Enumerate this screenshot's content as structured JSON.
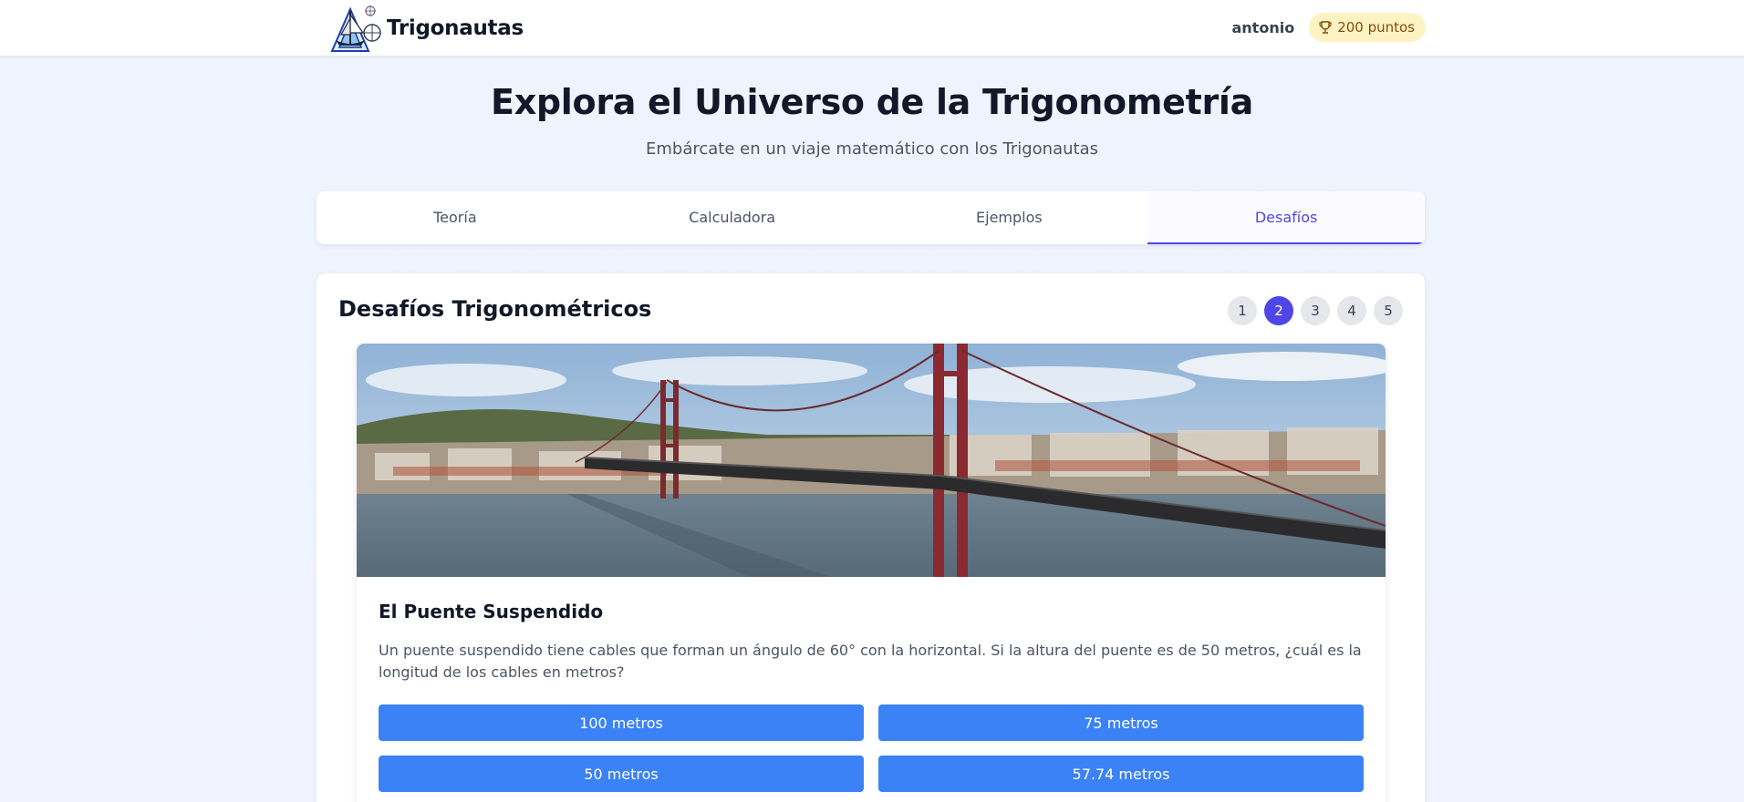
{
  "header": {
    "brand": "Trigonautas",
    "username": "antonio",
    "points": "200 puntos",
    "logo_icon": "compass-ship-logo-icon",
    "points_icon": "trophy-icon"
  },
  "hero": {
    "title": "Explora el Universo de la Trigonometría",
    "subtitle": "Embárcate en un viaje matemático con los Trigonautas"
  },
  "tabs": [
    {
      "label": "Teoría",
      "active": false
    },
    {
      "label": "Calculadora",
      "active": false
    },
    {
      "label": "Ejemplos",
      "active": false
    },
    {
      "label": "Desafíos",
      "active": true
    }
  ],
  "challenges": {
    "section_title": "Desafíos Trigonométricos",
    "pages": [
      "1",
      "2",
      "3",
      "4",
      "5"
    ],
    "current_page": "2",
    "current": {
      "title": "El Puente Suspendido",
      "question": "Un puente suspendido tiene cables que forman un ángulo de 60° con la horizontal. Si la altura del puente es de 50 metros, ¿cuál es la longitud de los cables en metros?",
      "answers": [
        "100 metros",
        "75 metros",
        "50 metros",
        "57.74 metros"
      ]
    }
  },
  "colors": {
    "accent": "#4f46e5",
    "answer_button": "#3b82f6",
    "points_badge_bg": "#fdf3c2",
    "points_badge_text": "#854d0e"
  }
}
